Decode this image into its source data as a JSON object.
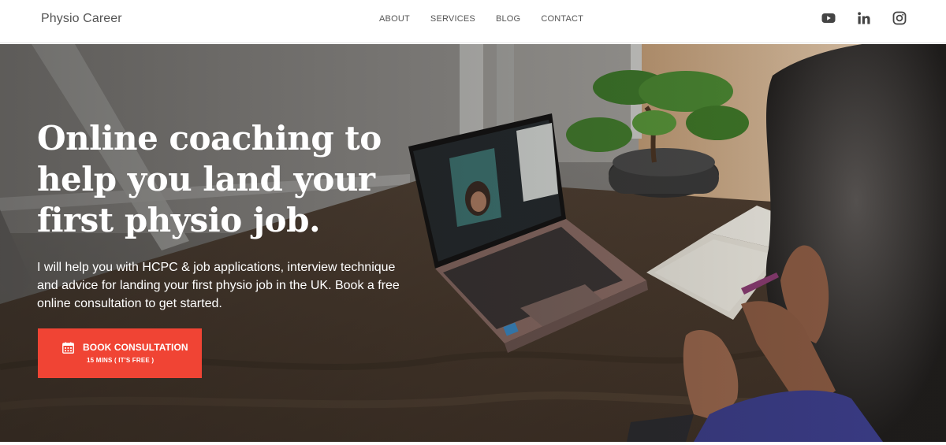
{
  "header": {
    "brand": "Physio Career",
    "nav": [
      {
        "label": "ABOUT"
      },
      {
        "label": "SERVICES"
      },
      {
        "label": "BLOG"
      },
      {
        "label": "CONTACT"
      }
    ],
    "social": [
      "youtube-icon",
      "linkedin-icon",
      "instagram-icon"
    ]
  },
  "hero": {
    "title": "Online coaching to help you land your first physio job.",
    "description": "I will help you with HCPC & job applications, interview technique and advice for landing your first physio job in the UK. Book a free online consultation to get started.",
    "cta": {
      "label": "BOOK CONSULTATION",
      "sublabel": "15 MINS ( IT'S FREE )",
      "icon": "calendar-icon",
      "color": "#f04434"
    }
  }
}
